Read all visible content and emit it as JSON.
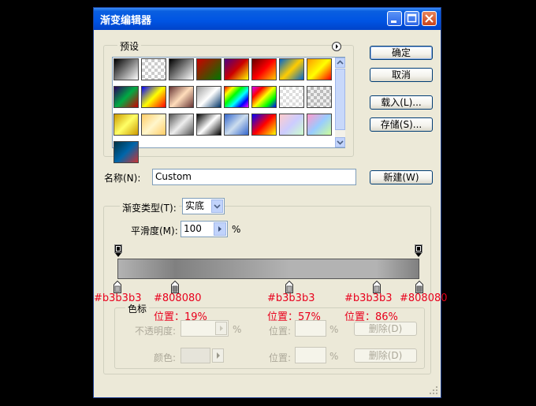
{
  "window": {
    "title": "渐变编辑器"
  },
  "buttons": {
    "ok": "确定",
    "cancel": "取消",
    "load": "载入(L)...",
    "save": "存储(S)...",
    "new": "新建(W)"
  },
  "presets": {
    "label": "预设"
  },
  "name": {
    "label": "名称(N):",
    "value": "Custom"
  },
  "gradient_type": {
    "label": "渐变类型(T):",
    "value": "实底"
  },
  "smoothness": {
    "label": "平滑度(M):",
    "value": "100",
    "unit": "%"
  },
  "stops_group": {
    "label": "色标",
    "opacity_label": "不透明度:",
    "opacity_unit": "%",
    "position_label": "位置:",
    "position_unit": "%",
    "delete_label": "删除(D)",
    "color_label": "颜色:"
  },
  "annotations": [
    {
      "color": "#b3b3b3",
      "position": ""
    },
    {
      "color": "#808080",
      "position": "位置：19%"
    },
    {
      "color": "#b3b3b3",
      "position": "位置：57%"
    },
    {
      "color": "#b3b3b3",
      "position": "位置：86%"
    },
    {
      "color": "#808080",
      "position": ""
    }
  ],
  "gradient_stops": [
    {
      "color": "#b3b3b3",
      "location": 0
    },
    {
      "color": "#808080",
      "location": 19
    },
    {
      "color": "#b3b3b3",
      "location": 57
    },
    {
      "color": "#b3b3b3",
      "location": 86
    },
    {
      "color": "#808080",
      "location": 100
    }
  ]
}
